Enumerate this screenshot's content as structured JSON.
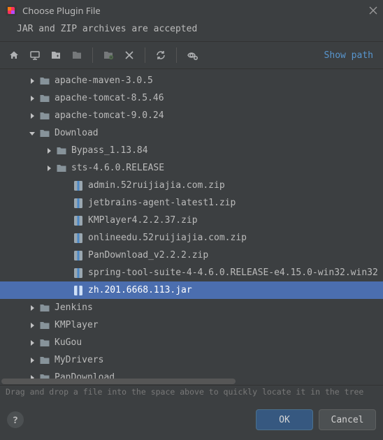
{
  "window": {
    "title": "Choose Plugin File",
    "subtitle": "JAR and ZIP archives are accepted"
  },
  "toolbar": {
    "show_path_label": "Show path"
  },
  "tree": {
    "items": [
      {
        "depth": 1,
        "arrow": "right",
        "icon": "folder",
        "label": "apache-maven-3.0.5",
        "selected": false
      },
      {
        "depth": 1,
        "arrow": "right",
        "icon": "folder",
        "label": "apache-tomcat-8.5.46",
        "selected": false
      },
      {
        "depth": 1,
        "arrow": "right",
        "icon": "folder",
        "label": "apache-tomcat-9.0.24",
        "selected": false
      },
      {
        "depth": 1,
        "arrow": "down",
        "icon": "folder",
        "label": "Download",
        "selected": false
      },
      {
        "depth": 2,
        "arrow": "right",
        "icon": "folder",
        "label": "Bypass_1.13.84",
        "selected": false
      },
      {
        "depth": 2,
        "arrow": "right",
        "icon": "folder",
        "label": "sts-4.6.0.RELEASE",
        "selected": false
      },
      {
        "depth": 3,
        "arrow": "",
        "icon": "archive",
        "label": "admin.52ruijiajia.com.zip",
        "selected": false
      },
      {
        "depth": 3,
        "arrow": "",
        "icon": "archive",
        "label": "jetbrains-agent-latest1.zip",
        "selected": false
      },
      {
        "depth": 3,
        "arrow": "",
        "icon": "archive",
        "label": "KMPlayer4.2.2.37.zip",
        "selected": false
      },
      {
        "depth": 3,
        "arrow": "",
        "icon": "archive",
        "label": "onlineedu.52ruijiajia.com.zip",
        "selected": false
      },
      {
        "depth": 3,
        "arrow": "",
        "icon": "archive",
        "label": "PanDownload_v2.2.2.zip",
        "selected": false
      },
      {
        "depth": 3,
        "arrow": "",
        "icon": "archive",
        "label": "spring-tool-suite-4-4.6.0.RELEASE-e4.15.0-win32.win32",
        "selected": false
      },
      {
        "depth": 3,
        "arrow": "",
        "icon": "archive",
        "label": "zh.201.6668.113.jar",
        "selected": true
      },
      {
        "depth": 1,
        "arrow": "right",
        "icon": "folder",
        "label": "Jenkins",
        "selected": false
      },
      {
        "depth": 1,
        "arrow": "right",
        "icon": "folder",
        "label": "KMPlayer",
        "selected": false
      },
      {
        "depth": 1,
        "arrow": "right",
        "icon": "folder",
        "label": "KuGou",
        "selected": false
      },
      {
        "depth": 1,
        "arrow": "right",
        "icon": "folder",
        "label": "MyDrivers",
        "selected": false
      },
      {
        "depth": 1,
        "arrow": "right",
        "icon": "folder",
        "label": "PanDownload",
        "selected": false
      }
    ]
  },
  "hint": "Drag and drop a file into the space above to quickly locate it in the tree",
  "footer": {
    "ok_label": "OK",
    "cancel_label": "Cancel",
    "help_label": "?"
  }
}
